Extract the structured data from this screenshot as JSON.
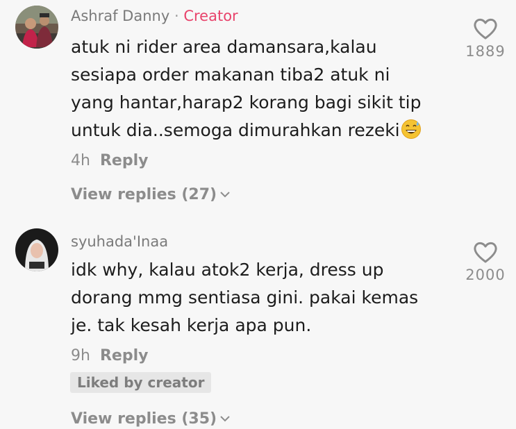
{
  "comments": [
    {
      "username": "Ashraf Danny",
      "separator": "·",
      "badge": "Creator",
      "text": "atuk ni rider area damansara,kalau\nsesiapa order makanan tiba2 atuk ni\nyang hantar,harap2 korang bagi sikit tip\nuntuk dia..semoga dimurahkan rezeki",
      "emoji": "grinning-sweat-emoji",
      "time": "4h",
      "reply_label": "Reply",
      "likes": "1889",
      "view_replies": "View replies (27)"
    },
    {
      "username": "syuhada'Inaa",
      "text": "idk why, kalau atok2 kerja, dress up\ndorang mmg sentiasa gini. pakai kemas\nje. tak kesah kerja apa pun.",
      "time": "9h",
      "reply_label": "Reply",
      "likes": "2000",
      "liked_by": "Liked by creator",
      "view_replies": "View replies (35)"
    }
  ],
  "colors": {
    "background": "#f7f7f7",
    "creator_badge": "#e8436b",
    "secondary_text": "#8c8c8c",
    "primary_text": "#1c1c1c"
  }
}
